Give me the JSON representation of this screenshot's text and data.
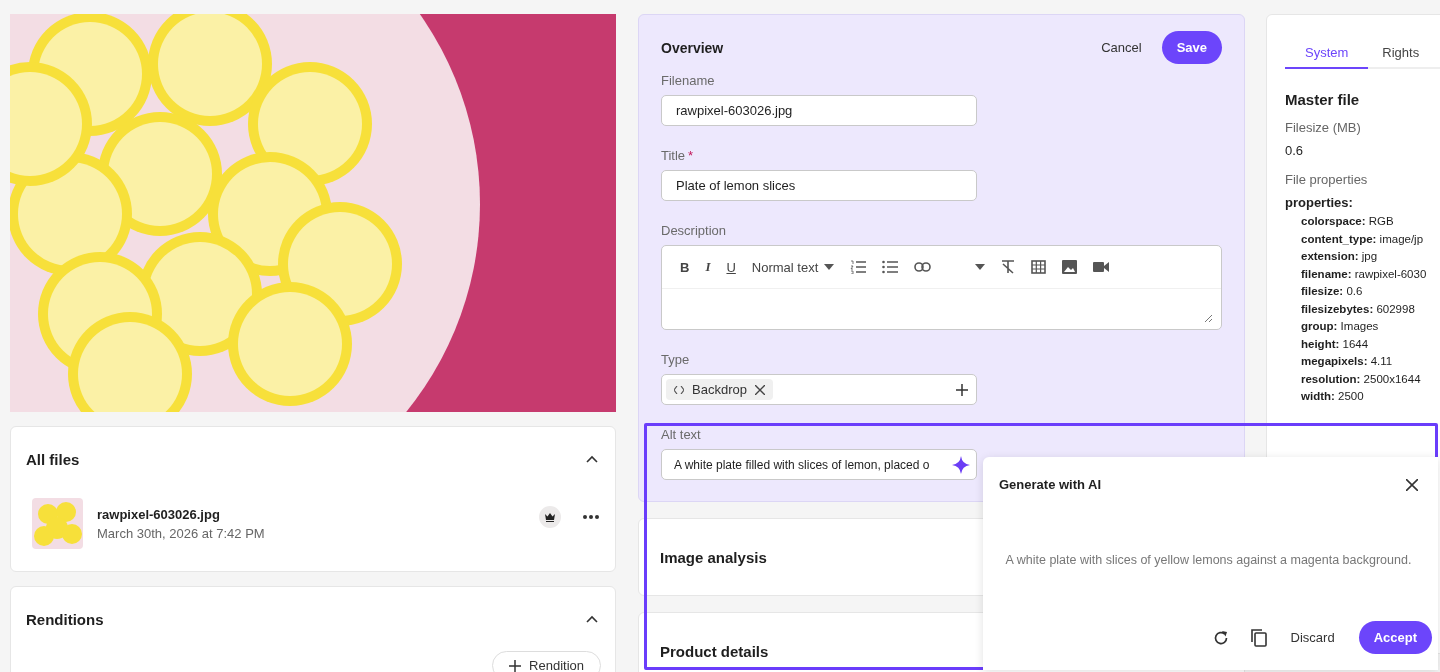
{
  "all_files": {
    "title": "All files",
    "expanded": true,
    "files": [
      {
        "name": "rawpixel-603026.jpg",
        "date": "March 30th, 2026 at 7:42 PM"
      }
    ]
  },
  "renditions": {
    "title": "Renditions",
    "expanded": true,
    "add_button": "Rendition"
  },
  "overview": {
    "title": "Overview",
    "cancel": "Cancel",
    "save": "Save",
    "filename": {
      "label": "Filename",
      "value": "rawpixel-603026.jpg"
    },
    "title_field": {
      "label": "Title",
      "required": true,
      "required_mark": "*",
      "value": "Plate of lemon slices"
    },
    "description": {
      "label": "Description",
      "bold": "B",
      "italic": "I",
      "underline": "U",
      "text_style": "Normal text"
    },
    "type": {
      "label": "Type",
      "tags": [
        {
          "label": "Backdrop"
        }
      ]
    },
    "alt_text": {
      "label": "Alt text",
      "value": "A white plate filled with slices of lemon, placed o"
    }
  },
  "sections": [
    {
      "title": "Image analysis"
    },
    {
      "title": "Product details"
    }
  ],
  "side_panel": {
    "tabs": [
      {
        "label": "System",
        "selected": true
      },
      {
        "label": "Rights",
        "selected": false
      }
    ],
    "heading": "Master file",
    "filesize_label": "Filesize (MB)",
    "filesize_value": "0.6",
    "file_properties_label": "File properties",
    "properties_key": "properties:",
    "properties": [
      {
        "key": "colorspace:",
        "value": "RGB"
      },
      {
        "key": "content_type:",
        "value": "image/jp"
      },
      {
        "key": "extension:",
        "value": "jpg"
      },
      {
        "key": "filename:",
        "value": "rawpixel-6030"
      },
      {
        "key": "filesize:",
        "value": "0.6"
      },
      {
        "key": "filesizebytes:",
        "value": "602998"
      },
      {
        "key": "group:",
        "value": "Images"
      },
      {
        "key": "height:",
        "value": "1644"
      },
      {
        "key": "megapixels:",
        "value": "4.11"
      },
      {
        "key": "resolution:",
        "value": "2500x1644"
      },
      {
        "key": "width:",
        "value": "2500"
      }
    ]
  },
  "ai_popup": {
    "title": "Generate with AI",
    "suggestion": "A white plate with slices of yellow lemons against a magenta background.",
    "discard": "Discard",
    "accept": "Accept"
  }
}
